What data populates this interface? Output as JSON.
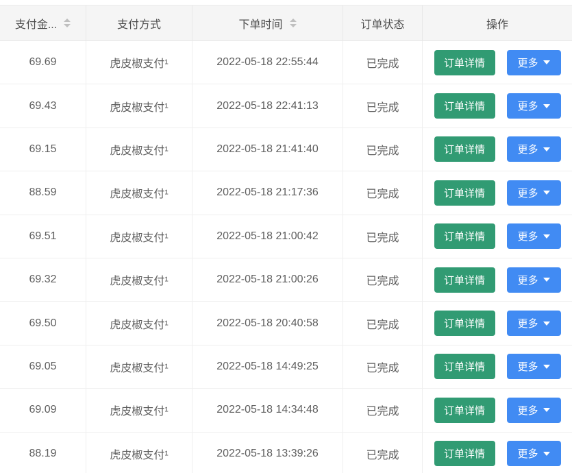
{
  "colors": {
    "detail_button_green": "#319b73",
    "more_button_blue": "#418bf3",
    "header_bg": "#f5f5f5"
  },
  "table": {
    "columns": [
      {
        "label": "支付金...",
        "sortable": true
      },
      {
        "label": "支付方式",
        "sortable": false
      },
      {
        "label": "下单时间",
        "sortable": true
      },
      {
        "label": "订单状态",
        "sortable": false
      },
      {
        "label": "操作",
        "sortable": false
      }
    ],
    "actions": {
      "detail": "订单详情",
      "more": "更多"
    },
    "rows": [
      {
        "amount": "69.69",
        "method": "虎皮椒支付¹",
        "time": "2022-05-18 22:55:44",
        "status": "已完成"
      },
      {
        "amount": "69.43",
        "method": "虎皮椒支付¹",
        "time": "2022-05-18 22:41:13",
        "status": "已完成"
      },
      {
        "amount": "69.15",
        "method": "虎皮椒支付¹",
        "time": "2022-05-18 21:41:40",
        "status": "已完成"
      },
      {
        "amount": "88.59",
        "method": "虎皮椒支付¹",
        "time": "2022-05-18 21:17:36",
        "status": "已完成"
      },
      {
        "amount": "69.51",
        "method": "虎皮椒支付¹",
        "time": "2022-05-18 21:00:42",
        "status": "已完成"
      },
      {
        "amount": "69.32",
        "method": "虎皮椒支付¹",
        "time": "2022-05-18 21:00:26",
        "status": "已完成"
      },
      {
        "amount": "69.50",
        "method": "虎皮椒支付¹",
        "time": "2022-05-18 20:40:58",
        "status": "已完成"
      },
      {
        "amount": "69.05",
        "method": "虎皮椒支付¹",
        "time": "2022-05-18 14:49:25",
        "status": "已完成"
      },
      {
        "amount": "69.09",
        "method": "虎皮椒支付¹",
        "time": "2022-05-18 14:34:48",
        "status": "已完成"
      },
      {
        "amount": "88.19",
        "method": "虎皮椒支付¹",
        "time": "2022-05-18 13:39:26",
        "status": "已完成"
      }
    ]
  }
}
